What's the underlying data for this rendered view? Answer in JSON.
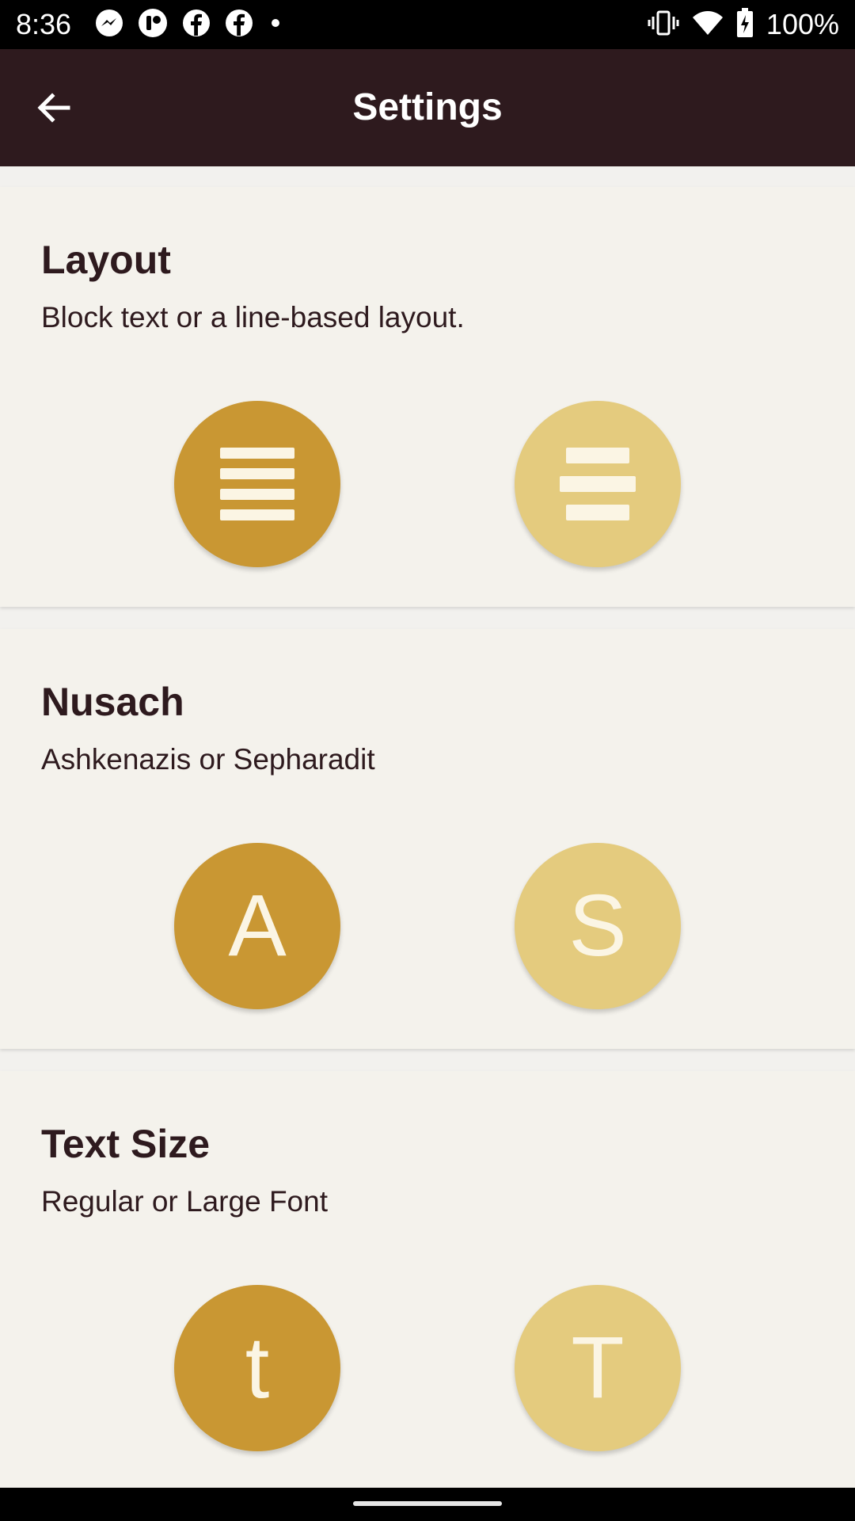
{
  "status_bar": {
    "time": "8:36",
    "battery": "100%",
    "left_icons": [
      "messenger-icon",
      "app-icon",
      "facebook-icon",
      "facebook-icon",
      "dot-icon"
    ],
    "right_icons": [
      "vibrate-icon",
      "wifi-icon",
      "battery-charging-icon"
    ]
  },
  "app_bar": {
    "title": "Settings",
    "back_icon": "back-arrow-icon"
  },
  "sections": [
    {
      "title": "Layout",
      "subtitle": "Block text or a line-based layout.",
      "options": [
        {
          "icon": "block-text-icon",
          "selected": true
        },
        {
          "icon": "line-layout-icon",
          "selected": false
        }
      ]
    },
    {
      "title": "Nusach",
      "subtitle": "Ashkenazis or Sepharadit",
      "options": [
        {
          "label": "A",
          "selected": true
        },
        {
          "label": "S",
          "selected": false
        }
      ]
    },
    {
      "title": "Text Size",
      "subtitle": "Regular or Large Font",
      "options": [
        {
          "label": "t",
          "selected": true
        },
        {
          "label": "T",
          "selected": false
        }
      ]
    }
  ],
  "colors": {
    "app_bar": "#2e1a1e",
    "selected": "#c99733",
    "unselected": "#e4cb7e",
    "card": "#f4f2ec",
    "text": "#2e1a1e"
  }
}
